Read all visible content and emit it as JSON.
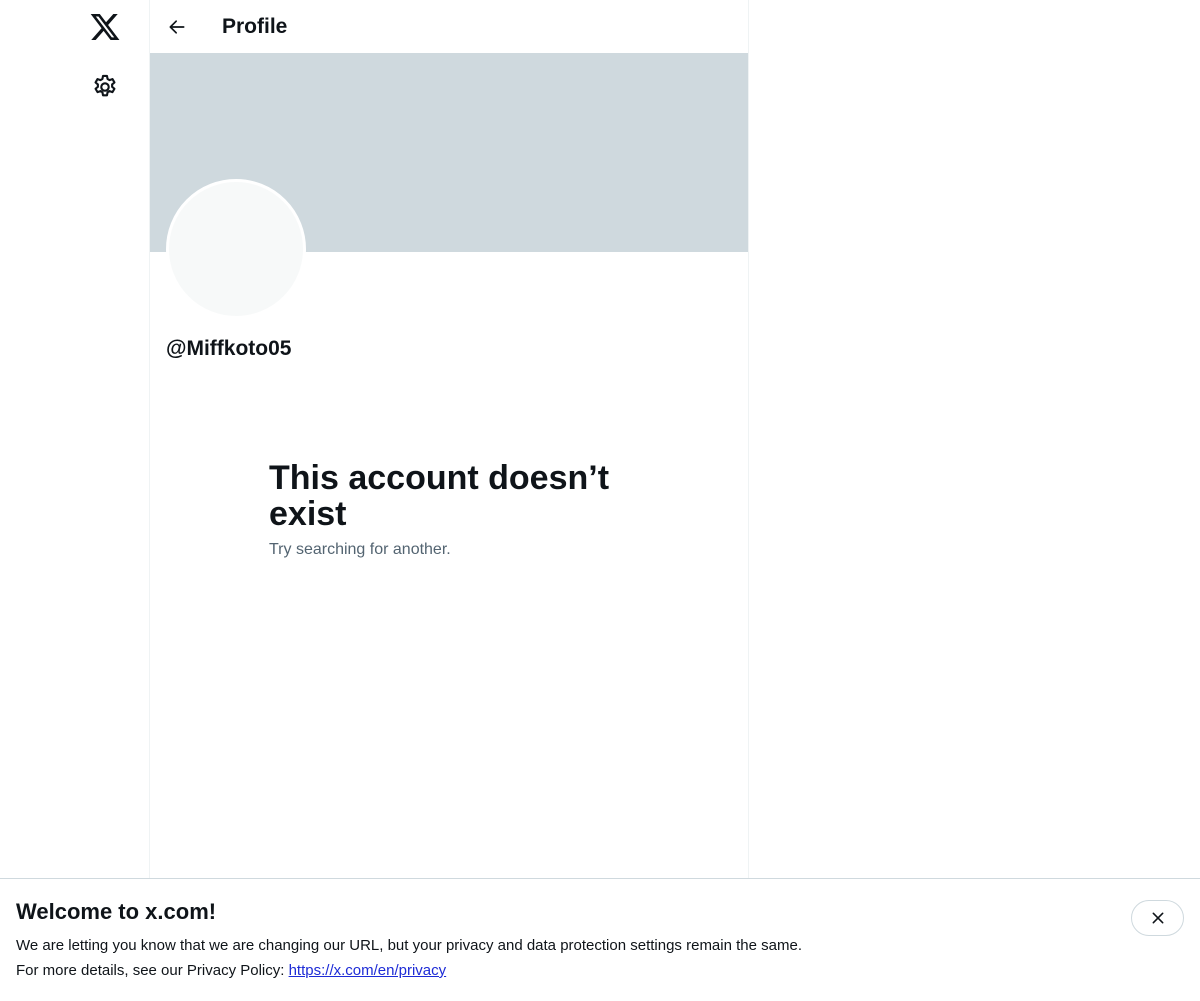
{
  "sidebar": {
    "logo_icon": "x-logo-icon",
    "settings_icon": "gear-icon"
  },
  "header": {
    "back_icon": "arrow-left-icon",
    "title": "Profile"
  },
  "profile": {
    "handle": "@Miffkoto05"
  },
  "empty_state": {
    "title": "This account doesn’t exist",
    "subtitle": "Try searching for another."
  },
  "welcome_banner": {
    "title": "Welcome to x.com!",
    "line1": "We are letting you know that we are changing our URL, but your privacy and data protection settings remain the same.",
    "line2_prefix": "For more details, see our Privacy Policy: ",
    "link_text": "https://x.com/en/privacy",
    "close_icon": "close-icon"
  },
  "colors": {
    "banner": "#cfd9de",
    "text": "#0f1419",
    "secondary_text": "#536471",
    "link": "#1d2bd6"
  }
}
